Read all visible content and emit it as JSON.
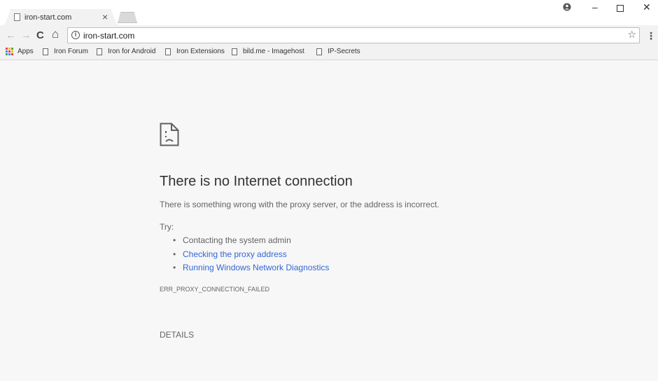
{
  "window": {
    "tab_title": "iron-start.com",
    "tab_close": "×",
    "controls": {
      "account": "account-icon",
      "minimize": "–",
      "maximize": "☐",
      "close": "✕"
    }
  },
  "toolbar": {
    "url": "iron-start.com",
    "back": "←",
    "forward": "→",
    "reload": "C",
    "home": "⌂",
    "star": "☆",
    "menu": "⋮"
  },
  "bookmarks": [
    {
      "label": "Apps",
      "icon": "apps-grid-icon"
    },
    {
      "label": "Iron Forum",
      "icon": "page-icon"
    },
    {
      "label": "Iron for Android",
      "icon": "page-icon"
    },
    {
      "label": "Iron Extensions",
      "icon": "page-icon"
    },
    {
      "label": "bild.me - Imagehost",
      "icon": "page-icon"
    },
    {
      "label": "IP-Secrets",
      "icon": "page-icon"
    }
  ],
  "error": {
    "title": "There is no Internet connection",
    "description": "There is something wrong with the proxy server, or the address is incorrect.",
    "try_label": "Try:",
    "suggestions": [
      {
        "text": "Contacting the system admin",
        "link": false
      },
      {
        "text": "Checking the proxy address",
        "link": true
      },
      {
        "text": "Running Windows Network Diagnostics",
        "link": true
      }
    ],
    "code": "ERR_PROXY_CONNECTION_FAILED",
    "details_button": "DETAILS"
  },
  "colors": {
    "link": "#3367d6",
    "text": "#646464",
    "background": "#f7f7f7"
  }
}
